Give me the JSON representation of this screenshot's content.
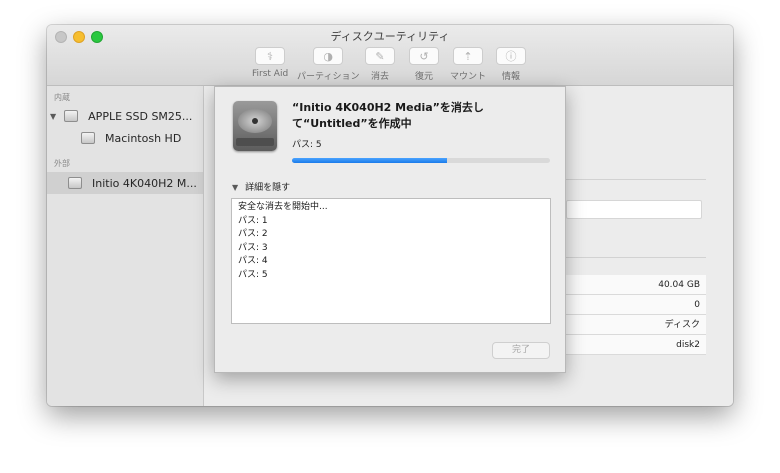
{
  "window": {
    "title": "ディスクユーティリティ",
    "toolbar": [
      {
        "label": "First Aid",
        "icon": "stethoscope-icon"
      },
      {
        "label": "パーティション",
        "icon": "partition-icon"
      },
      {
        "label": "消去",
        "icon": "erase-icon"
      },
      {
        "label": "復元",
        "icon": "restore-icon"
      },
      {
        "label": "マウント",
        "icon": "mount-icon"
      },
      {
        "label": "情報",
        "icon": "info-icon"
      }
    ]
  },
  "sidebar": {
    "internal_header": "内蔵",
    "external_header": "外部",
    "items": [
      {
        "label": "APPLE SSD SM25..."
      },
      {
        "label": "Macintosh HD"
      },
      {
        "label": "Initio 4K040H2 M..."
      }
    ]
  },
  "info_values": [
    "40.04 GB",
    "0",
    "ディスク",
    "disk2"
  ],
  "sheet": {
    "title": "“Initio 4K040H2 Media”を消去して“Untitled”を作成中",
    "status": "パス: 5",
    "progress": 0.6,
    "details_toggle": "詳細を隠す",
    "log": [
      "安全な消去を開始中...",
      "パス: 1",
      "パス: 2",
      "パス: 3",
      "パス: 4",
      "パス: 5"
    ],
    "done_button": "完了"
  },
  "colors": {
    "accent": "#1a7bea",
    "close": "#c7c7c7",
    "minimize": "#f6be2f",
    "maximize": "#2ac840"
  }
}
